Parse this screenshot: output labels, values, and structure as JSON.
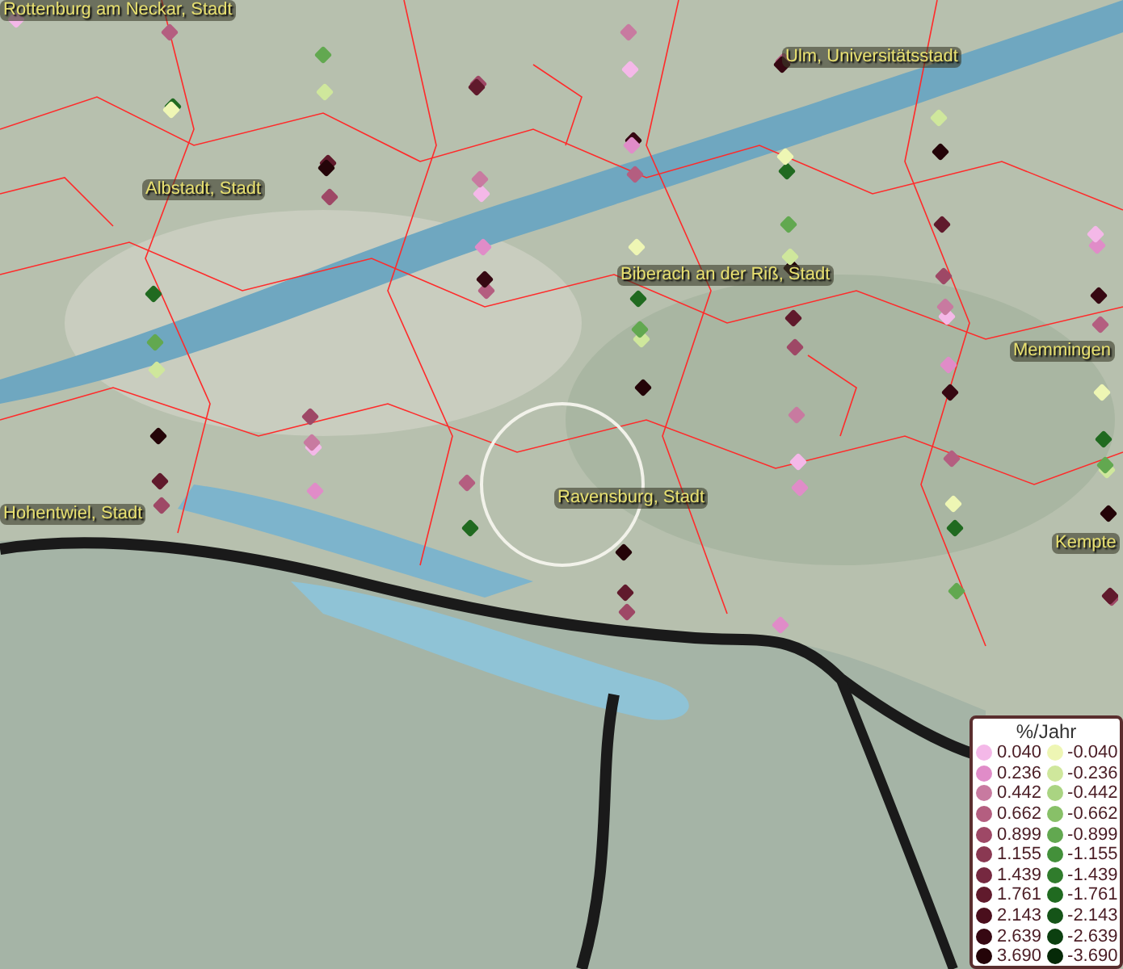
{
  "map": {
    "place_labels": [
      {
        "text": "Rottenburg am Neckar, Stadt"
      },
      {
        "text": "Ulm, Universitätsstadt"
      },
      {
        "text": "Albstadt, Stadt"
      },
      {
        "text": "Biberach an der Riß, Stadt"
      },
      {
        "text": "Memmingen"
      },
      {
        "text": "Hohentwiel, Stadt"
      },
      {
        "text": "Ravensburg, Stadt"
      },
      {
        "text": "Kempte"
      }
    ]
  },
  "legend": {
    "title": "%/Jahr",
    "columns": [
      {
        "items": [
          {
            "label": "0.040",
            "color": "#f4b8e8"
          },
          {
            "label": "0.236",
            "color": "#e08cc8"
          },
          {
            "label": "0.442",
            "color": "#c87aa0"
          },
          {
            "label": "0.662",
            "color": "#b45e80"
          },
          {
            "label": "0.899",
            "color": "#9e4866"
          },
          {
            "label": "1.155",
            "color": "#8a3852"
          },
          {
            "label": "1.439",
            "color": "#762840"
          },
          {
            "label": "1.761",
            "color": "#601a2c"
          },
          {
            "label": "2.143",
            "color": "#4a0e1c"
          },
          {
            "label": "2.639",
            "color": "#360812"
          },
          {
            "label": "3.690",
            "color": "#240408"
          }
        ]
      },
      {
        "items": [
          {
            "label": "-0.040",
            "color": "#eef6b4"
          },
          {
            "label": "-0.236",
            "color": "#cfe79c"
          },
          {
            "label": "-0.442",
            "color": "#aad482"
          },
          {
            "label": "-0.662",
            "color": "#88c068"
          },
          {
            "label": "-0.899",
            "color": "#62a850"
          },
          {
            "label": "-1.155",
            "color": "#43903a"
          },
          {
            "label": "-1.439",
            "color": "#307c2c"
          },
          {
            "label": "-1.761",
            "color": "#206a20"
          },
          {
            "label": "-2.143",
            "color": "#155418"
          },
          {
            "label": "-2.639",
            "color": "#0c4010"
          },
          {
            "label": "-3.690",
            "color": "#062a08"
          }
        ]
      }
    ]
  }
}
